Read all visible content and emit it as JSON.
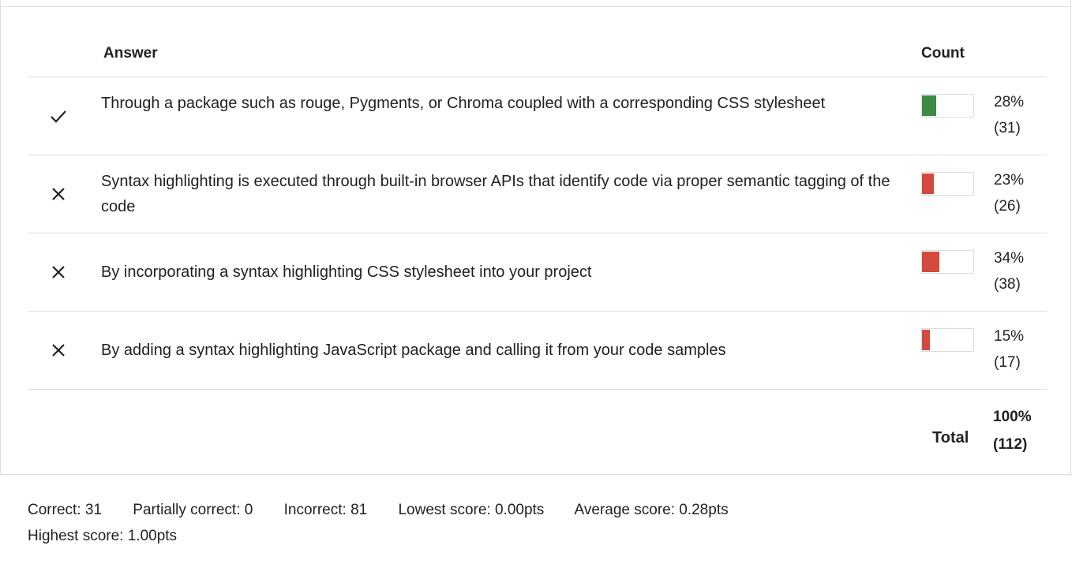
{
  "table": {
    "header_answer": "Answer",
    "header_count": "Count",
    "rows": [
      {
        "correct": true,
        "icon": "check-icon",
        "text": "Through a package such as rouge, Pygments, or Chroma coupled with a corresponding CSS stylesheet",
        "percent": "28%",
        "count": "(31)",
        "fraction": 0.28,
        "bar_color": "#3d8b45"
      },
      {
        "correct": false,
        "icon": "close-icon",
        "text": "Syntax highlighting is executed through built-in browser APIs that identify code via proper semantic tagging of the code",
        "percent": "23%",
        "count": "(26)",
        "fraction": 0.23,
        "bar_color": "#d24b3e"
      },
      {
        "correct": false,
        "icon": "close-icon",
        "text": "By incorporating a syntax highlighting CSS stylesheet into your project",
        "percent": "34%",
        "count": "(38)",
        "fraction": 0.34,
        "bar_color": "#d24b3e"
      },
      {
        "correct": false,
        "icon": "close-icon",
        "text": "By adding a syntax highlighting JavaScript package and calling it from your code samples",
        "percent": "15%",
        "count": "(17)",
        "fraction": 0.15,
        "bar_color": "#d24b3e"
      }
    ],
    "total_label": "Total",
    "total_percent": "100%",
    "total_count": "(112)"
  },
  "stats": {
    "correct": "Correct: 31",
    "partially_correct": "Partially correct: 0",
    "incorrect": "Incorrect: 81",
    "lowest": "Lowest score: 0.00pts",
    "average": "Average score: 0.28pts",
    "highest": "Highest score: 1.00pts"
  }
}
